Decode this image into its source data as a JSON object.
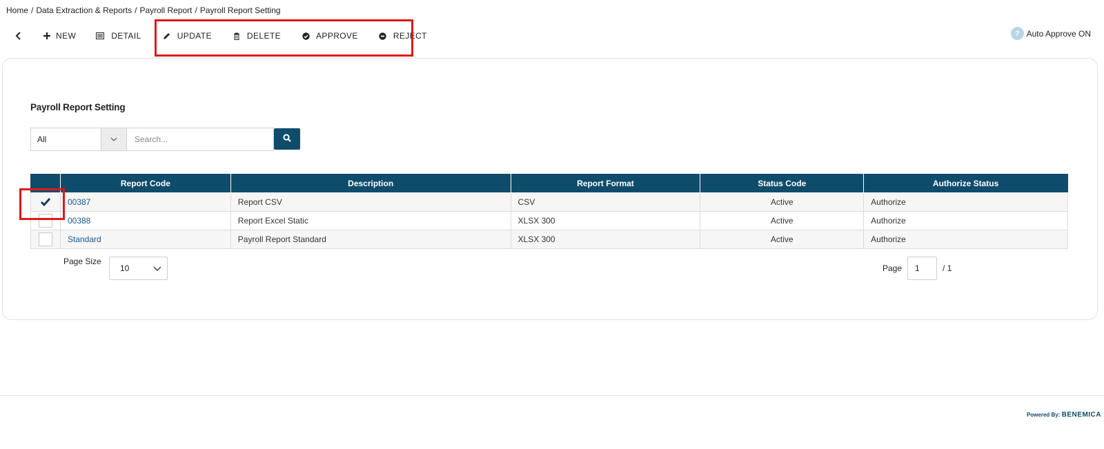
{
  "breadcrumb": [
    "Home",
    "Data Extraction & Reports",
    "Payroll Report",
    "Payroll Report Setting"
  ],
  "toolbar": {
    "back_icon": "chevron-left-icon",
    "new_label": "NEW",
    "detail_label": "DETAIL",
    "update_label": "UPDATE",
    "delete_label": "DELETE",
    "approve_label": "APPROVE",
    "reject_label": "REJECT"
  },
  "auto_approve": {
    "icon": "?",
    "label": "Auto Approve ON"
  },
  "page_title": "Payroll Report Setting",
  "filter": {
    "selected": "All",
    "placeholder": "Search..."
  },
  "table": {
    "columns": [
      "Report Code",
      "Description",
      "Report Format",
      "Status Code",
      "Authorize Status"
    ],
    "rows": [
      {
        "checked": true,
        "code": "00387",
        "description": "Report CSV",
        "format": "CSV",
        "status": "Active",
        "authorize": "Authorize"
      },
      {
        "checked": false,
        "code": "00388",
        "description": "Report Excel Static",
        "format": "XLSX 300",
        "status": "Active",
        "authorize": "Authorize"
      },
      {
        "checked": false,
        "code": "Standard",
        "description": "Payroll Report Standard",
        "format": "XLSX 300",
        "status": "Active",
        "authorize": "Authorize"
      }
    ]
  },
  "pagination": {
    "page_size_label": "Page Size",
    "page_size": "10",
    "page_label": "Page",
    "current_page": "1",
    "total_pages": "/ 1"
  },
  "footer": {
    "powered_by": "Powered By:",
    "brand": "BENEMICA"
  },
  "colors": {
    "primary": "#0f4c6b",
    "highlight": "#e01818",
    "link": "#1a5a8c"
  }
}
